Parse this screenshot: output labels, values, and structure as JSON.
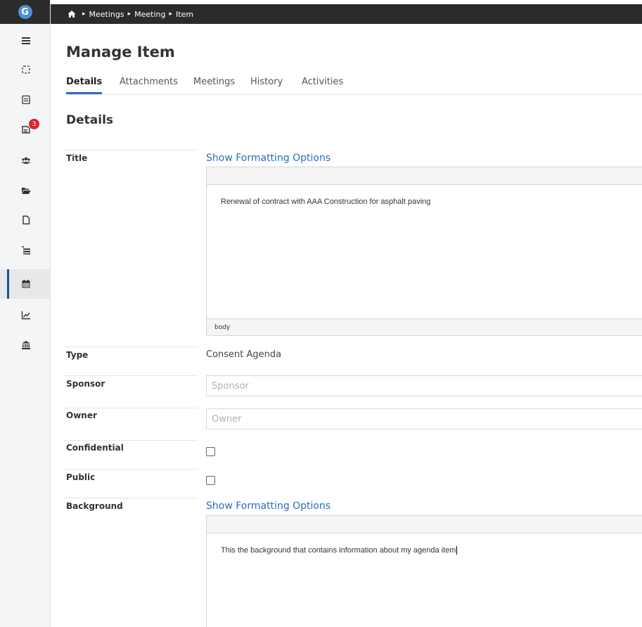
{
  "sidebar": {
    "logo": "G",
    "items": [
      {
        "icon": "hamburger-menu-icon"
      },
      {
        "icon": "dashboard-icon"
      },
      {
        "icon": "agenda-icon"
      },
      {
        "icon": "inbox-icon",
        "badge": "3"
      },
      {
        "icon": "users-icon"
      },
      {
        "icon": "folder-open-icon"
      },
      {
        "icon": "document-icon"
      },
      {
        "icon": "list-icon"
      },
      {
        "icon": "calendar-icon",
        "active": true
      },
      {
        "icon": "line-chart-icon"
      },
      {
        "icon": "government-building-icon"
      }
    ]
  },
  "breadcrumb": {
    "items": [
      "Meetings",
      "Meeting",
      "Item"
    ]
  },
  "page": {
    "title": "Manage Item",
    "tabs": [
      "Details",
      "Attachments",
      "Meetings",
      "History",
      "Activities"
    ],
    "active_tab": "Details",
    "section_title": "Details"
  },
  "form": {
    "title": {
      "label": "Title",
      "format_link": "Show Formatting Options",
      "content": "Renewal of contract with AAA Construction for asphalt paving",
      "status": "body"
    },
    "type": {
      "label": "Type",
      "value": "Consent Agenda"
    },
    "sponsor": {
      "label": "Sponsor",
      "value": "",
      "placeholder": "Sponsor"
    },
    "owner": {
      "label": "Owner",
      "value": "",
      "placeholder": "Owner"
    },
    "confidential": {
      "label": "Confidential",
      "checked": false
    },
    "public": {
      "label": "Public",
      "checked": false
    },
    "background": {
      "label": "Background",
      "format_link": "Show Formatting Options",
      "content": "This the background that contains information about my agenda item"
    }
  },
  "colors": {
    "accent": "#2a6ebb",
    "topbar": "#2b2b2b",
    "badge": "#d9232e"
  }
}
